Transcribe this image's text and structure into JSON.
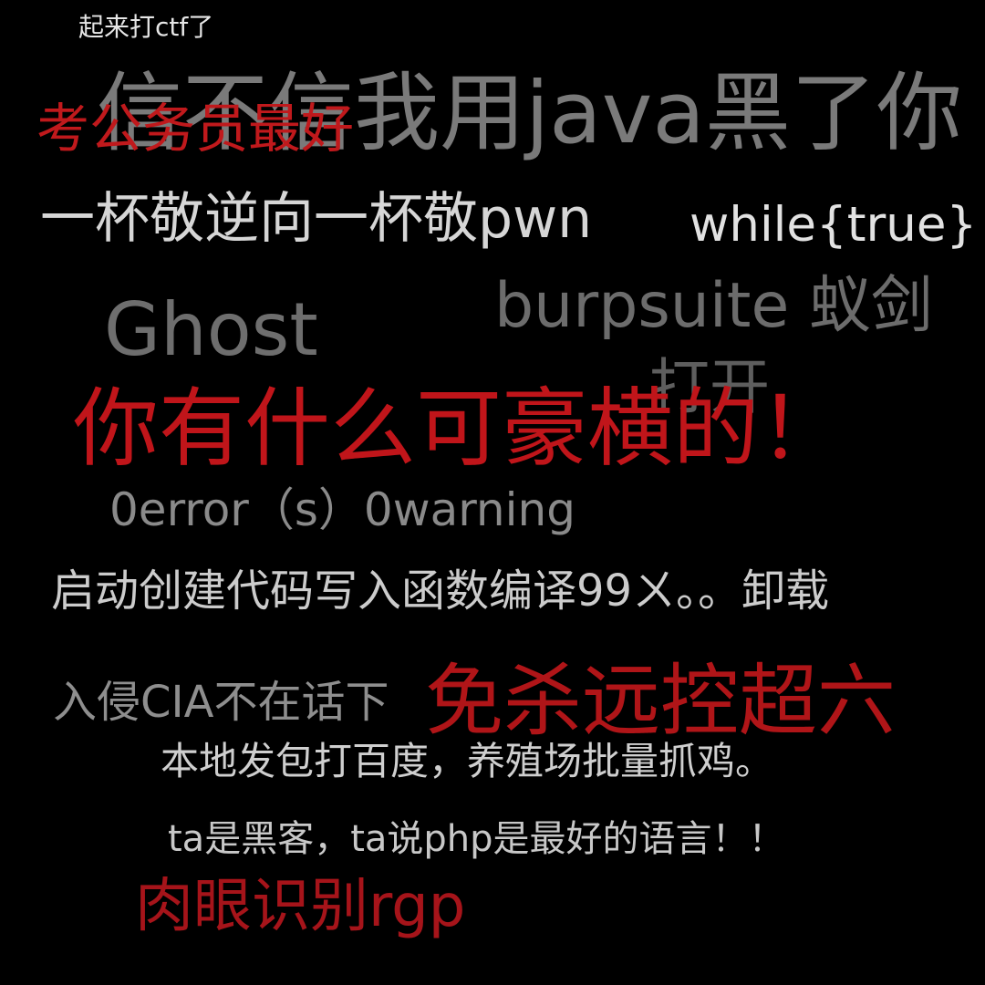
{
  "phrases": {
    "title": "起来打ctf了",
    "java": "信不信我用java黑了你",
    "civil_service": "考公务员最好",
    "pwn": "一杯敬逆向一杯敬pwn",
    "while_true": "while{true}",
    "burpsuite": "burpsuite 蚁剑",
    "ghost": "Ghost",
    "open": "打开",
    "rich": "你有什么可豪横的！",
    "errors": "0error（s）0warning",
    "compile": "启动创建代码写入函数编译99ㄨ。。卸载",
    "cia": "入侵CIA不在话下",
    "remote": "免杀远控超六",
    "baidu": "本地发包打百度，养殖场批量抓鸡。",
    "php": "ta是黑客，ta说php是最好的语言！！",
    "rgp": "肉眼识别rgp"
  },
  "colors": {
    "background": "#000000",
    "red_accent": "#c0151a",
    "gray_text": "#7a7a7a",
    "light_text": "#e0e0e0"
  }
}
